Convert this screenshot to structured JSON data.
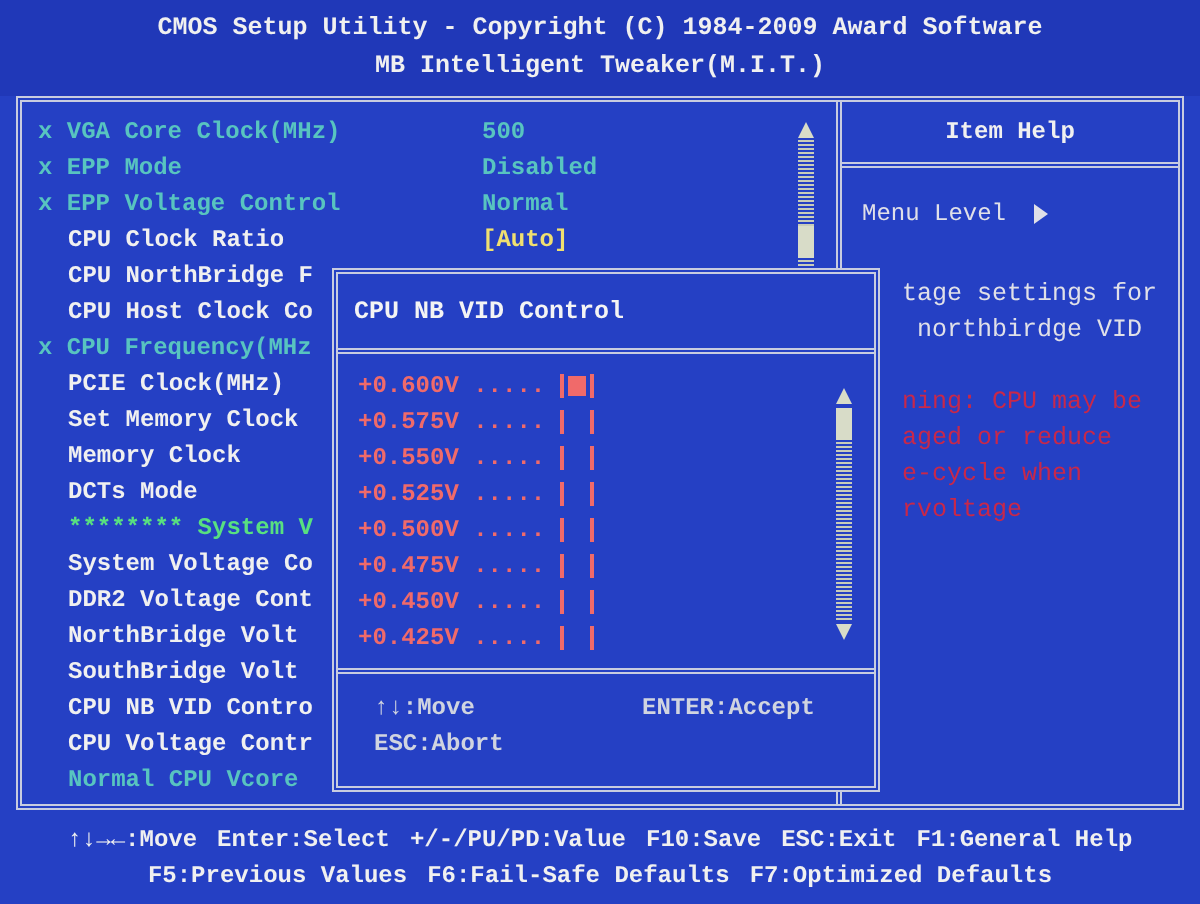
{
  "header": {
    "title": "CMOS Setup Utility - Copyright (C) 1984-2009 Award Software",
    "subtitle": "MB Intelligent Tweaker(M.I.T.)"
  },
  "menu": [
    {
      "kind": "disabled",
      "label": "x VGA Core Clock(MHz)",
      "value": "500"
    },
    {
      "kind": "disabled",
      "label": "x EPP Mode",
      "value": "Disabled"
    },
    {
      "kind": "disabled",
      "label": "x EPP Voltage Control",
      "value": "Normal"
    },
    {
      "kind": "item",
      "label": "CPU Clock Ratio",
      "value": "[Auto]"
    },
    {
      "kind": "item",
      "label": "CPU NorthBridge F"
    },
    {
      "kind": "item",
      "label": "CPU Host Clock Co"
    },
    {
      "kind": "disabled",
      "label": "x CPU Frequency(MHz"
    },
    {
      "kind": "item",
      "label": "PCIE Clock(MHz)"
    },
    {
      "kind": "item",
      "label": "Set Memory Clock"
    },
    {
      "kind": "item",
      "label": "Memory Clock"
    },
    {
      "kind": "item",
      "label": "DCTs Mode"
    },
    {
      "kind": "header",
      "label": "******** System V"
    },
    {
      "kind": "item",
      "label": "System Voltage Co"
    },
    {
      "kind": "item",
      "label": "DDR2 Voltage Cont"
    },
    {
      "kind": "item",
      "label": "NorthBridge Volt"
    },
    {
      "kind": "item",
      "label": "SouthBridge Volt"
    },
    {
      "kind": "item",
      "label": "CPU NB VID Contro"
    },
    {
      "kind": "item",
      "label": "CPU Voltage Contr"
    },
    {
      "kind": "info",
      "label": "Normal CPU Vcore"
    }
  ],
  "help": {
    "title": "Item Help",
    "menu_level": "Menu Level",
    "lines": [
      {
        "kind": "normal",
        "text": "tage settings for"
      },
      {
        "kind": "normal",
        "text": " northbirdge VID"
      },
      {
        "kind": "gap"
      },
      {
        "kind": "warning",
        "text": "ning: CPU may be"
      },
      {
        "kind": "warning",
        "text": "aged or reduce"
      },
      {
        "kind": "warning",
        "text": "e-cycle when"
      },
      {
        "kind": "warning",
        "text": "rvoltage"
      }
    ]
  },
  "popup": {
    "title": "CPU NB VID Control",
    "options": [
      {
        "value": "+0.600V",
        "dots": ".....",
        "selected": true
      },
      {
        "value": "+0.575V",
        "dots": ".....",
        "selected": false
      },
      {
        "value": "+0.550V",
        "dots": ".....",
        "selected": false
      },
      {
        "value": "+0.525V",
        "dots": ".....",
        "selected": false
      },
      {
        "value": "+0.500V",
        "dots": ".....",
        "selected": false
      },
      {
        "value": "+0.475V",
        "dots": ".....",
        "selected": false
      },
      {
        "value": "+0.450V",
        "dots": ".....",
        "selected": false
      },
      {
        "value": "+0.425V",
        "dots": ".....",
        "selected": false
      }
    ],
    "keys": [
      [
        "↑↓:Move",
        "ENTER:Accept"
      ],
      [
        "ESC:Abort"
      ]
    ]
  },
  "footer": [
    [
      "↑↓→←:Move",
      "Enter:Select",
      "+/-/PU/PD:Value",
      "F10:Save",
      "ESC:Exit",
      "F1:General Help"
    ],
    [
      "F5:Previous Values",
      "F6:Fail-Safe Defaults",
      "F7:Optimized Defaults"
    ]
  ]
}
